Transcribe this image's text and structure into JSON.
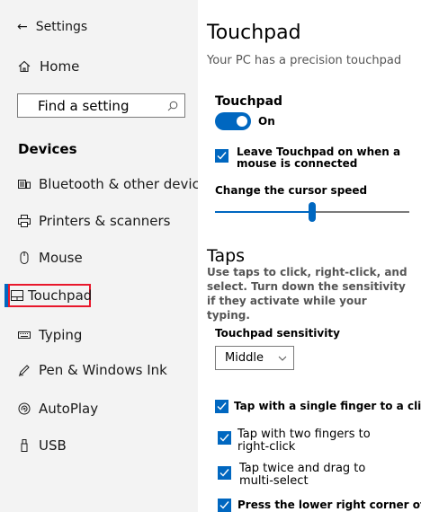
{
  "nav": {
    "back_label": "Settings",
    "home_label": "Home",
    "search_placeholder": "Find a setting",
    "section_title": "Devices",
    "items": [
      {
        "label": "Bluetooth & other devices",
        "icon": "keyboard-pair-icon"
      },
      {
        "label": "Printers & scanners",
        "icon": "printer-icon"
      },
      {
        "label": "Mouse",
        "icon": "mouse-icon"
      },
      {
        "label": "Touchpad",
        "icon": "touchpad-icon"
      },
      {
        "label": "Typing",
        "icon": "keyboard-icon"
      },
      {
        "label": "Pen & Windows Ink",
        "icon": "pen-icon"
      },
      {
        "label": "AutoPlay",
        "icon": "autoplay-icon"
      },
      {
        "label": "USB",
        "icon": "usb-icon"
      }
    ],
    "selected": "Touchpad"
  },
  "content": {
    "title": "Touchpad",
    "subtitle": "Your PC has a precision touchpad",
    "touchpad_heading": "Touchpad",
    "toggle_state": "On",
    "leave_on_label": "Leave Touchpad on when a mouse is connected",
    "cursor_speed_label": "Change the cursor speed",
    "cursor_speed_value": 0.5,
    "taps_heading": "Taps",
    "taps_description": "Use taps to click, right-click, and select. Turn down the sensitivity if they activate while your typing.",
    "sensitivity_label": "Touchpad sensitivity",
    "sensitivity_value": "Middle",
    "tap_options": [
      "Tap with a single finger to a click",
      "Tap with two fingers to right-click",
      "Tap twice and drag to multi-select",
      "Press the lower right corner of"
    ]
  },
  "colors": {
    "accent": "#0067c0",
    "highlight_box": "#e8172b"
  }
}
